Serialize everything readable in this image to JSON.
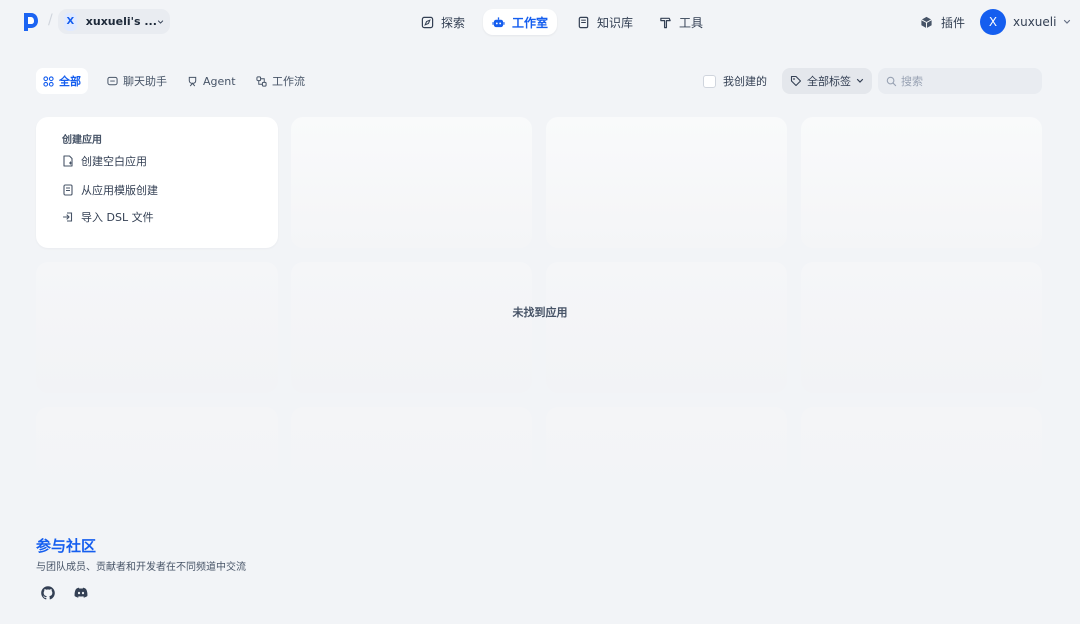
{
  "workspace": {
    "avatar_letter": "X",
    "name": "xuxueli's ..."
  },
  "nav": {
    "explore": "探索",
    "studio": "工作室",
    "knowledge": "知识库",
    "tools": "工具"
  },
  "header_right": {
    "plugins": "插件",
    "user_initial": "X",
    "user_name": "xuxueli"
  },
  "filters": {
    "tabs": [
      "全部",
      "聊天助手",
      "Agent",
      "工作流"
    ],
    "active_tab": "全部",
    "created_by_me": "我创建的",
    "all_tags": "全部标签",
    "search_placeholder": "搜索"
  },
  "create": {
    "title": "创建应用",
    "blank": "创建空白应用",
    "from_template": "从应用模版创建",
    "import_dsl": "导入 DSL 文件"
  },
  "empty_message": "未找到应用",
  "community": {
    "title": "参与社区",
    "subtitle": "与团队成员、贡献者和开发者在不同频道中交流"
  },
  "colors": {
    "accent": "#155eef",
    "background": "#f2f4f7",
    "card": "#ffffff"
  }
}
